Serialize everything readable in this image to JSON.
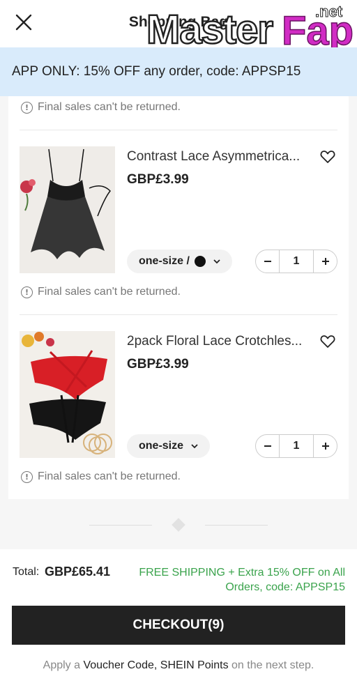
{
  "header": {
    "title": "Shopping Bag",
    "watermark": "MasterFap",
    "watermark_suffix": ".net"
  },
  "promo": {
    "text": "APP ONLY: 15% OFF any order, code: APPSP15"
  },
  "notices": {
    "final_sale": "Final sales can't be returned."
  },
  "items": [
    {
      "title": "Contrast Lace Asymmetrica...",
      "price": "GBP£3.99",
      "variant": "one-size /",
      "variant_color": "#111111",
      "quantity": "1",
      "image": "black-lace-babydoll"
    },
    {
      "title": "2pack Floral Lace Crotchles...",
      "price": "GBP£3.99",
      "variant": "one-size",
      "quantity": "1",
      "image": "red-and-black-lace-panties"
    }
  ],
  "footer": {
    "total_label": "Total:",
    "total_value": "GBP£65.41",
    "shipping_msg": "FREE SHIPPING + Extra 15% OFF on All Orders, code: APPSP15",
    "checkout_label": "CHECKOUT(9)",
    "note_prefix": "Apply a",
    "note_links": "Voucher Code, SHEIN Points",
    "note_suffix": "on the next step."
  },
  "colors": {
    "promo_bg": "#d9ebfb",
    "shipping_green": "#3aa34c",
    "checkout_bg": "#222222"
  }
}
